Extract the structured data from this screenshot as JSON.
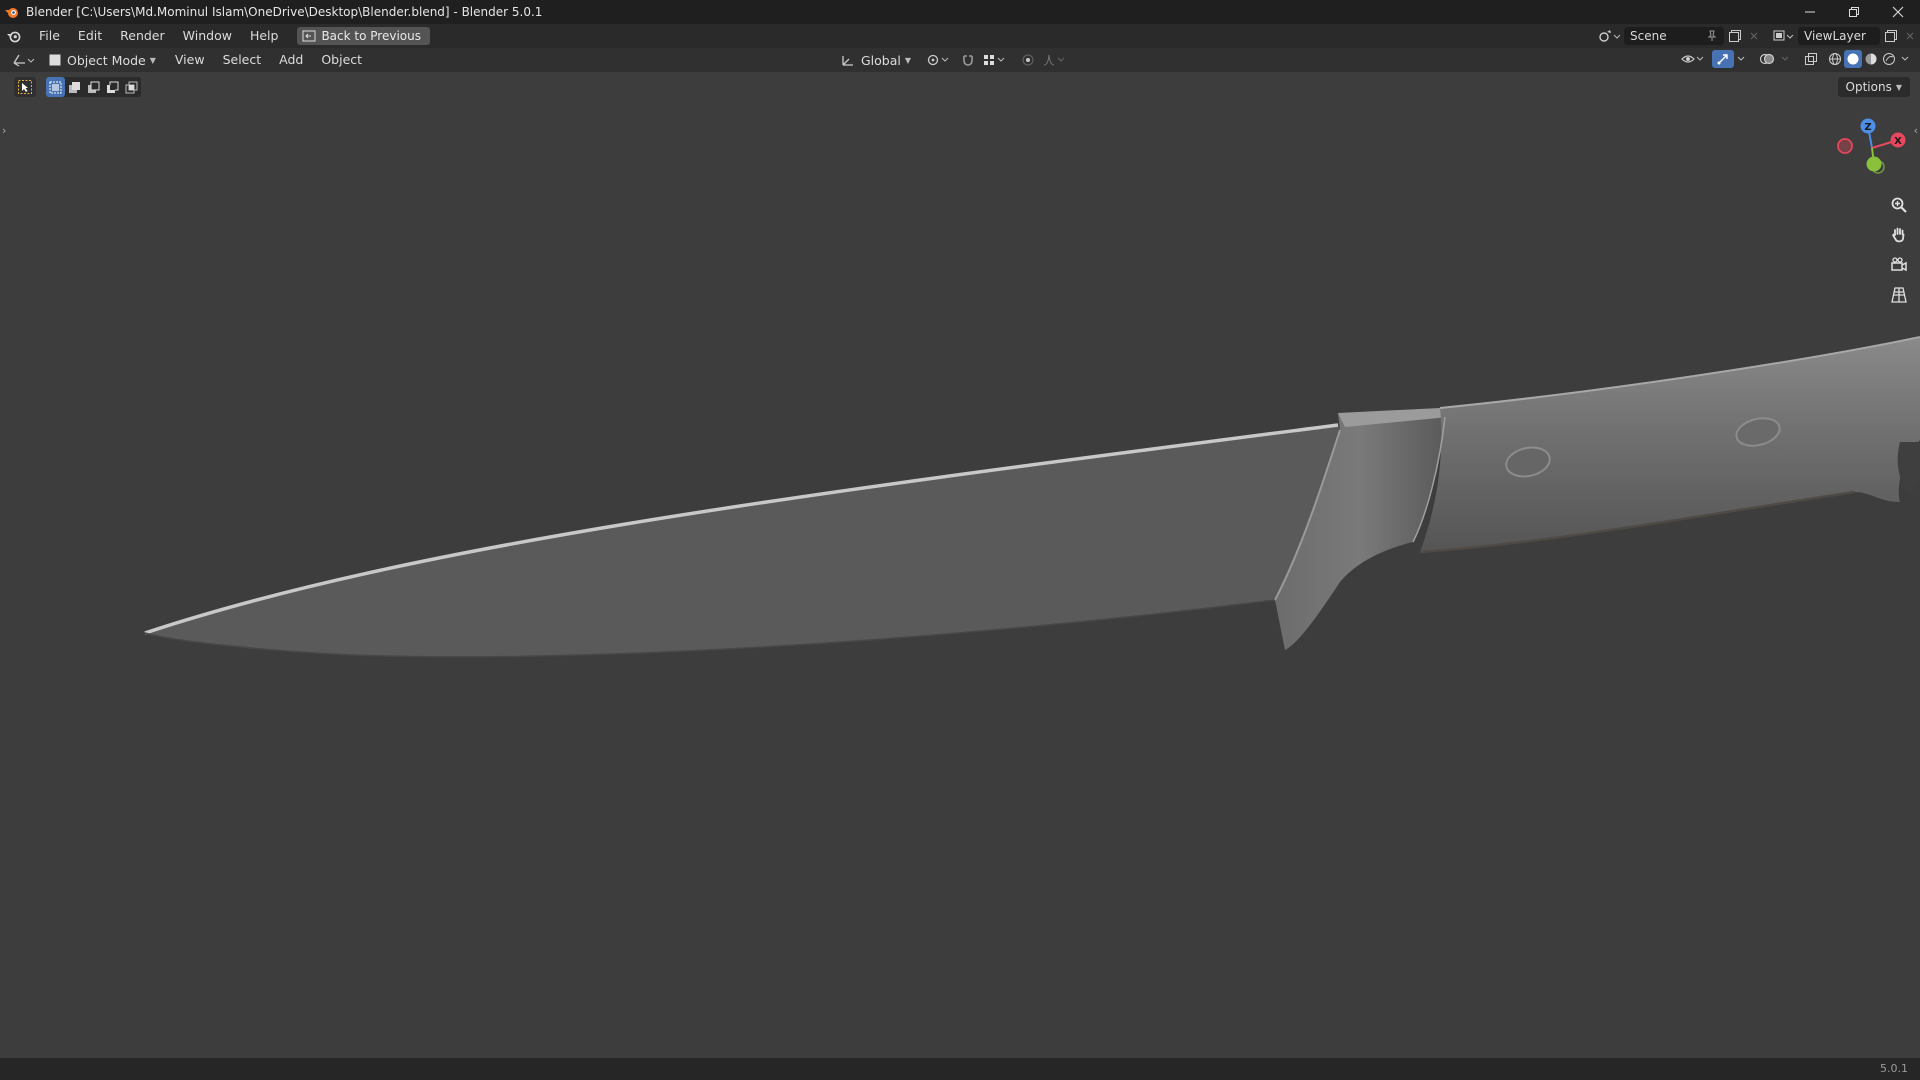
{
  "window": {
    "title": "Blender [C:\\Users\\Md.Mominul Islam\\OneDrive\\Desktop\\Blender.blend] - Blender 5.0.1",
    "controls": [
      "minimize-icon",
      "restore-icon",
      "close-icon"
    ]
  },
  "menu": {
    "items": [
      "File",
      "Edit",
      "Render",
      "Window",
      "Help"
    ],
    "back_label": "Back to Previous"
  },
  "scene": {
    "name": "Scene"
  },
  "viewlayer": {
    "name": "ViewLayer"
  },
  "viewport_header": {
    "mode": "Object Mode",
    "menus": [
      "View",
      "Select",
      "Add",
      "Object"
    ],
    "transform_orientation": "Global"
  },
  "toolbar": {
    "options_label": "Options"
  },
  "gizmo": {
    "x_label": "X",
    "z_label": "Z"
  },
  "status": {
    "version": "5.0.1"
  },
  "colors": {
    "accent": "#4772b3",
    "axis_x": "#e8475e",
    "axis_y": "#8ac13a",
    "axis_z": "#4c8ee8",
    "viewport_bg": "#3d3d3d"
  }
}
